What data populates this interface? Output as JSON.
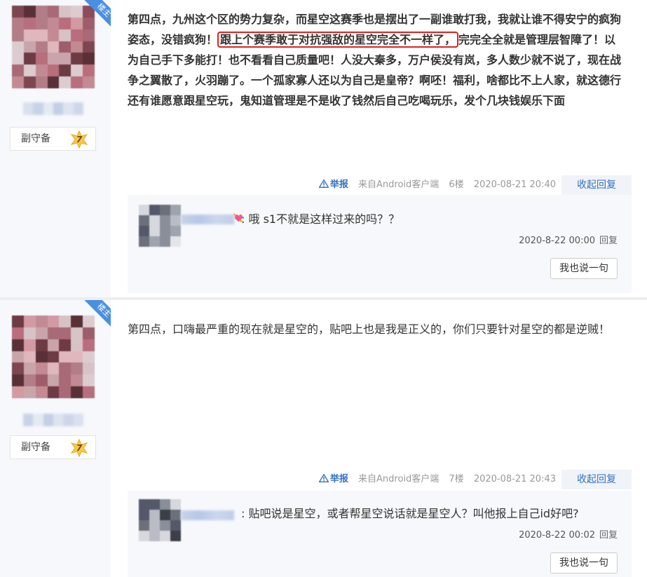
{
  "posts": [
    {
      "owner_tag": "楼主",
      "level_title": "副守备",
      "level_num": "7",
      "content_pre": "第四点，九州这个区的势力复杂，而星空这赛季也是摆出了一副谁敢打我，我就让谁不得安宁的疯狗姿态，没错疯狗！",
      "content_hl": "跟上个赛季敢于对抗强敌的星空完全不一样了，",
      "content_post": "完完全全就是管理层智障了！以为自己手下多能打！也不看看自己质量吧！人没大秦多，万户侯没有岚，多人数少就不说了，现在战争之翼散了，火羽蹦了。一个孤家寡人还以为自己是皇帝？啊呸！福利，啥都比不上人家，就这德行还有谁愿意跟星空玩，鬼知道管理是不是收了钱然后自己吃喝玩乐，发个几块钱娱乐下面",
      "meta": {
        "report": "举报",
        "source": "来自Android客户端",
        "floor": "6楼",
        "time": "2020-08-21 20:40",
        "collapse": "收起回复"
      },
      "reply": {
        "text": ": 哦 s1不就是这样过来的吗？？",
        "time": "2020-8-22 00:00",
        "reply_label": "回复",
        "button": "我也说一句"
      }
    },
    {
      "owner_tag": "楼主",
      "level_title": "副守备",
      "level_num": "7",
      "content": "第四点，口嗨最严重的现在就是星空的，贴吧上也是我是正义的，你们只要针对星空的都是逆贼！",
      "meta": {
        "report": "举报",
        "source": "来自Android客户端",
        "floor": "7楼",
        "time": "2020-08-21 20:43",
        "collapse": "收起回复"
      },
      "reply": {
        "text": ": 贴吧说是星空，或者帮星空说话就是星空人？叫他报上自己id好吧?",
        "time": "2020-8-22 00:02",
        "reply_label": "回复",
        "button": "我也说一句"
      }
    }
  ],
  "colors": {
    "accent": "#3470c4",
    "highlight_border": "#e02020",
    "sidebar_bg": "#f6f8fb",
    "owner_ribbon": "#4a90e2"
  },
  "icons": [
    "warning-triangle-icon",
    "level-star-icon"
  ]
}
